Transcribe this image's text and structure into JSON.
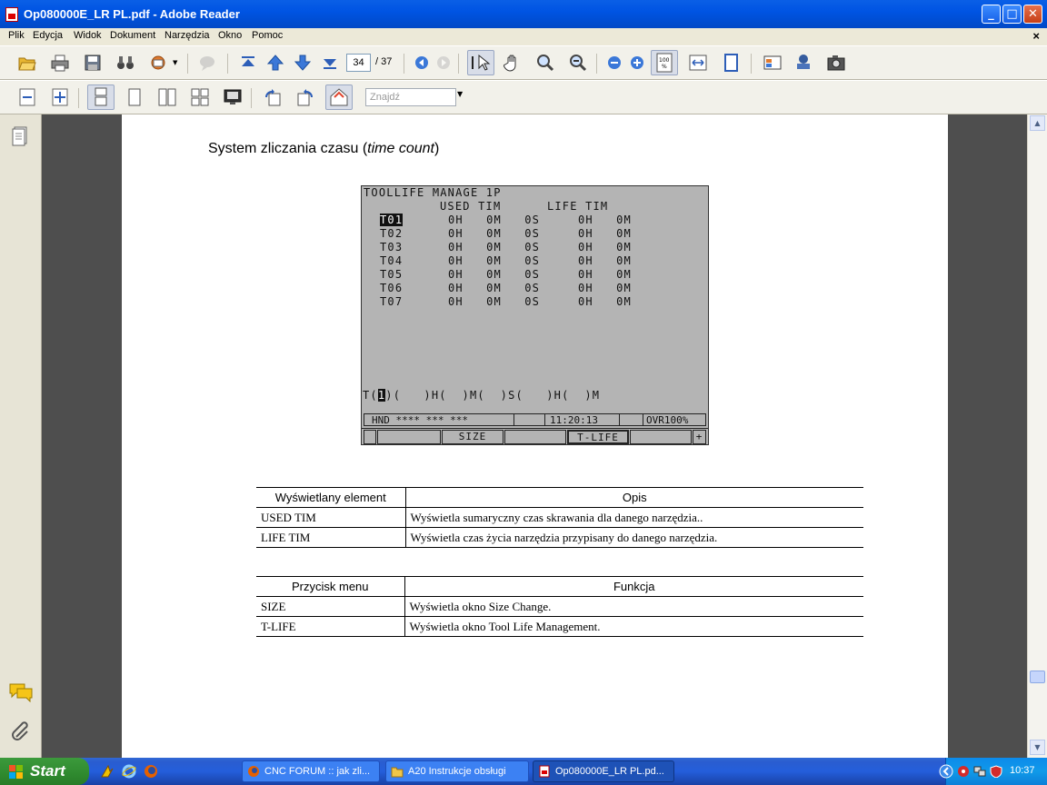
{
  "window": {
    "title": "Op080000E_LR PL.pdf - Adobe Reader",
    "min": "_",
    "max": "□",
    "close": "✕"
  },
  "menu": [
    "Plik",
    "Edycja",
    "Widok",
    "Dokument",
    "Narzędzia",
    "Okno",
    "Pomoc"
  ],
  "menu_close": "×",
  "toolbar": {
    "page_current": "34",
    "page_total": "/ 37",
    "zoom_label": "100 %"
  },
  "find": {
    "placeholder": "Znajdź"
  },
  "document": {
    "heading_prefix": "System zliczania czasu (",
    "heading_italic": "time count",
    "heading_suffix": ")",
    "cnc": {
      "title": "TOOLLIFE MANAGE 1P",
      "col_headers": "USED TIM      LIFE TIM",
      "rows": [
        {
          "tool": "T01",
          "used": "0H   0M   0S",
          "life": "0H   0M"
        },
        {
          "tool": "T02",
          "used": "0H   0M   0S",
          "life": "0H   0M"
        },
        {
          "tool": "T03",
          "used": "0H   0M   0S",
          "life": "0H   0M"
        },
        {
          "tool": "T04",
          "used": "0H   0M   0S",
          "life": "0H   0M"
        },
        {
          "tool": "T05",
          "used": "0H   0M   0S",
          "life": "0H   0M"
        },
        {
          "tool": "T06",
          "used": "0H   0M   0S",
          "life": "0H   0M"
        },
        {
          "tool": "T07",
          "used": "0H   0M   0S",
          "life": "0H   0M"
        }
      ],
      "input_prefix": "T(",
      "input_cursor": "1",
      "input_rest": ")(   )H(  )M(  )S(   )H(  )M",
      "status_mode": "HND **** *** ***",
      "status_time": "11:20:13",
      "status_ovr": "OVR100%",
      "softkeys": [
        "",
        "SIZE",
        "",
        "T-LIFE",
        "",
        "+"
      ]
    },
    "table1": {
      "headers": [
        "Wyświetlany element",
        "Opis"
      ],
      "rows": [
        [
          "USED TIM",
          "Wyświetla sumaryczny czas skrawania dla danego narzędzia.."
        ],
        [
          "LIFE TIM",
          "Wyświetla czas życia narzędzia przypisany do danego narzędzia."
        ]
      ]
    },
    "table2": {
      "headers": [
        "Przycisk menu",
        "Funkcja"
      ],
      "rows": [
        [
          "SIZE",
          "Wyświetla okno Size Change."
        ],
        [
          "T-LIFE",
          "Wyświetla okno Tool Life Management."
        ]
      ]
    }
  },
  "taskbar": {
    "start": "Start",
    "tasks": [
      "CNC FORUM :: jak zli...",
      "A20 Instrukcje obsługi",
      "Op080000E_LR PL.pd..."
    ],
    "clock": "10:37"
  },
  "icons": {
    "open": "folder-open-icon",
    "print": "printer-icon",
    "save": "save-icon",
    "find": "binoculars-icon",
    "accent": "#0054e3",
    "taskbar_green": "#3c9a3c"
  }
}
